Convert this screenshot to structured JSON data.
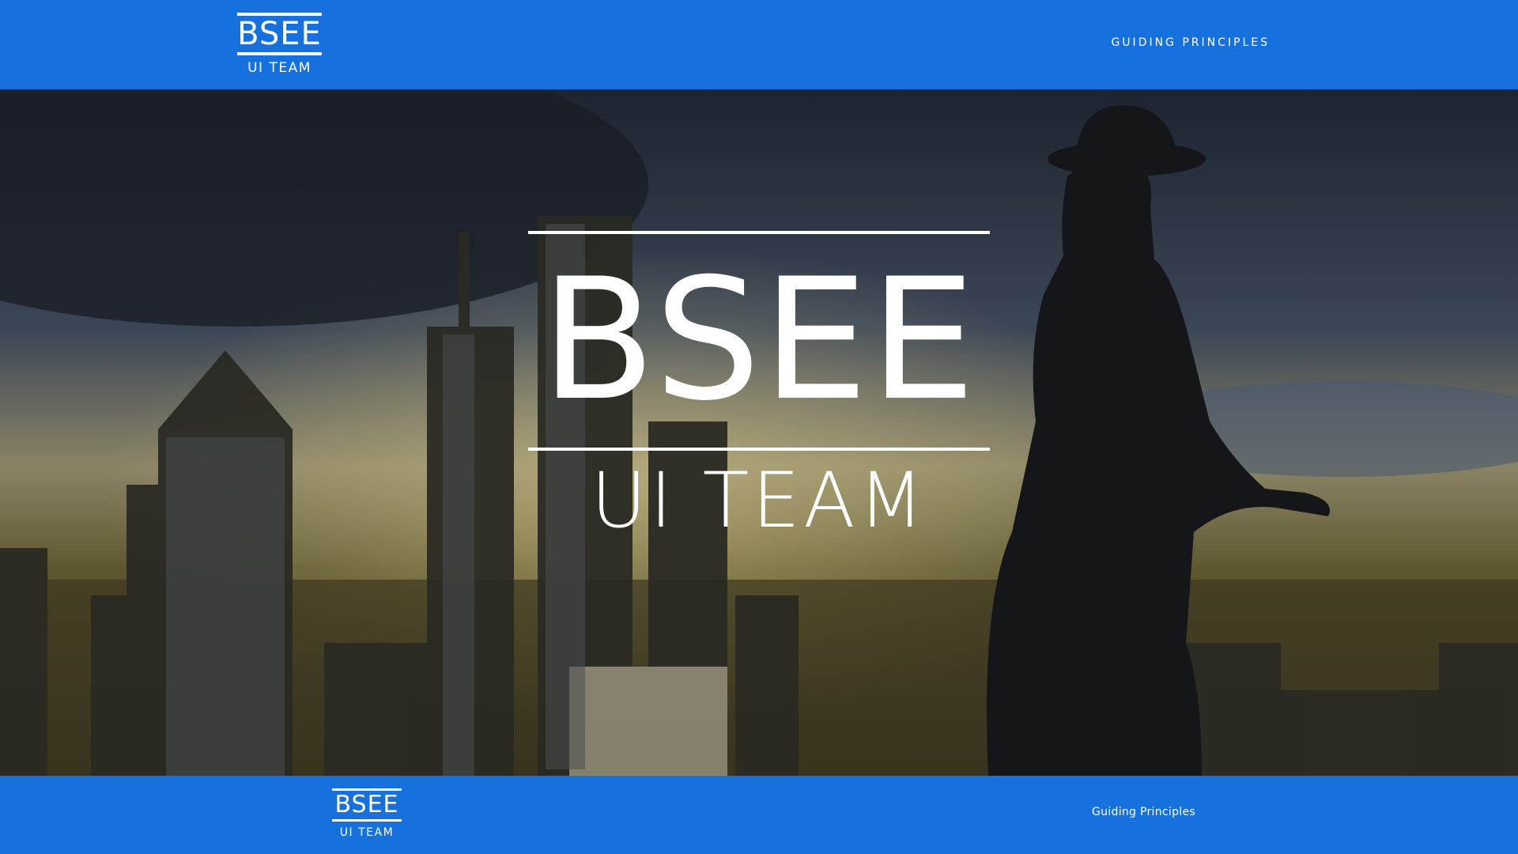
{
  "header": {
    "logo": {
      "title": "BSEE",
      "subtitle": "UI TEAM"
    },
    "nav": {
      "guiding_principles": "GUIDING PRINCIPLES"
    }
  },
  "hero": {
    "title": "BSEE",
    "subtitle": "UI TEAM",
    "background": "city-skyline-with-statue-photo"
  },
  "footer": {
    "logo": {
      "title": "BSEE",
      "subtitle": "UI TEAM"
    },
    "nav": {
      "guiding_principles": "Guiding Principles"
    }
  },
  "colors": {
    "brand_blue": "#1670dd",
    "text": "#ffffff"
  }
}
